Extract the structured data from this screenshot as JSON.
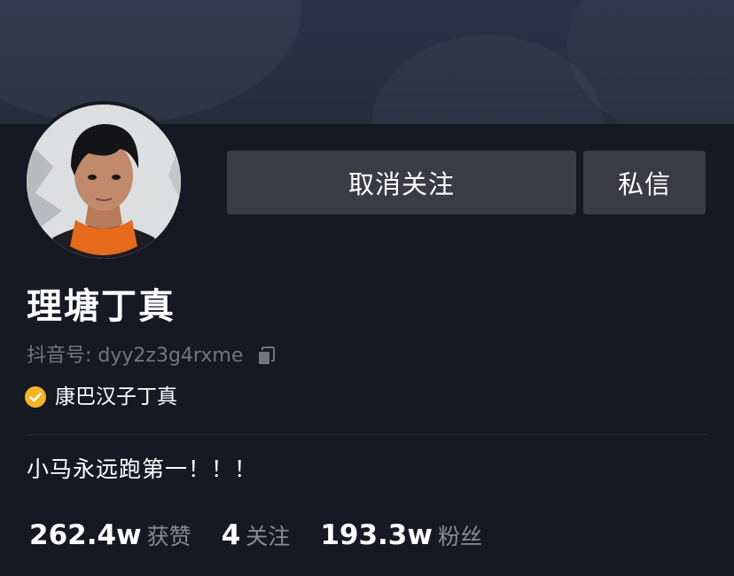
{
  "profile": {
    "name": "理塘丁真",
    "douyin_id": "抖音号: dyy2z3g4rxme",
    "verification": "康巴汉子丁真",
    "bio": "小马永远跑第一！！！"
  },
  "actions": {
    "unfollow_label": "取消关注",
    "message_label": "私信"
  },
  "stats": [
    {
      "value": "262.4w",
      "label": "获赞"
    },
    {
      "value": "4",
      "label": "关注"
    },
    {
      "value": "193.3w",
      "label": "粉丝"
    }
  ],
  "colors": {
    "background": "#161823",
    "button": "#3a3b45",
    "verify_badge": "#f5b425",
    "muted_text": "#73757c"
  },
  "icons": {
    "copy": "copy-icon",
    "verify": "verified-badge-icon"
  }
}
